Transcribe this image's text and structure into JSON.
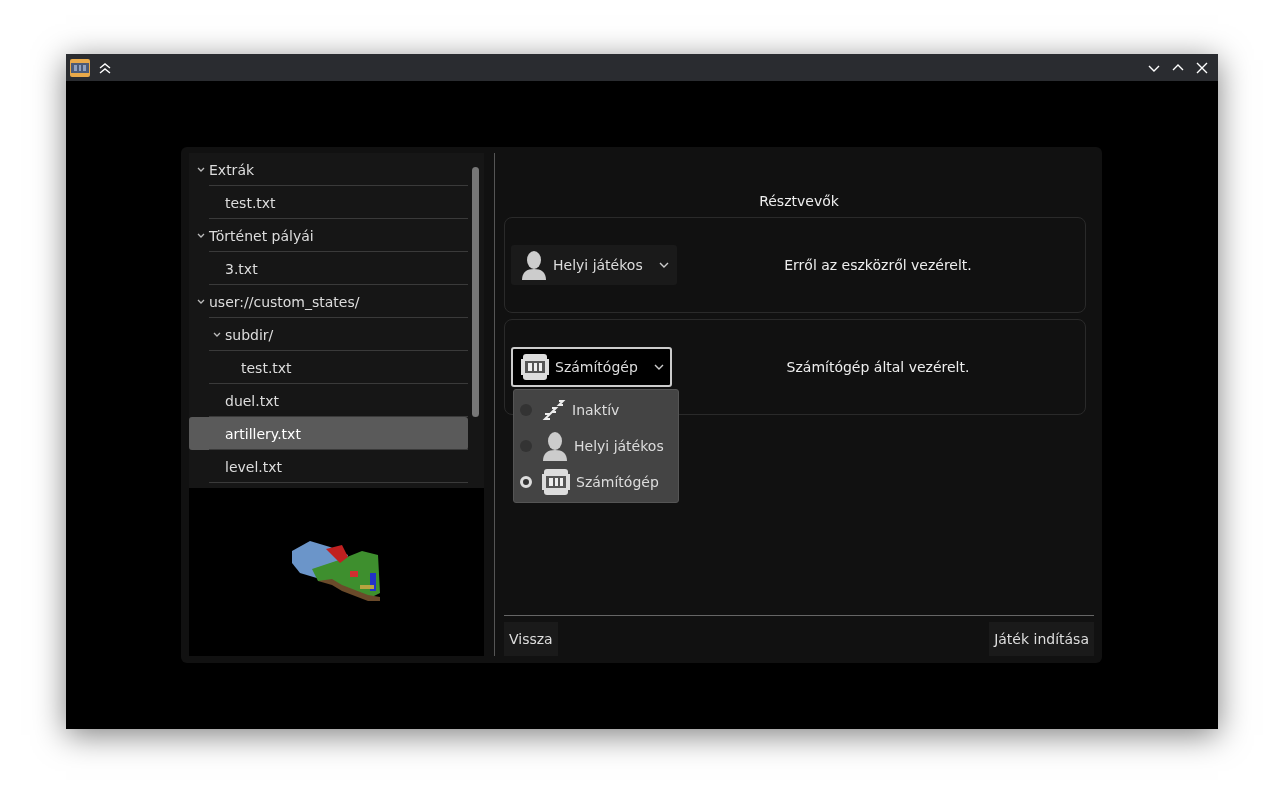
{
  "tree": [
    {
      "label": "Extrák",
      "expanded": true,
      "selected": false,
      "children": [
        {
          "label": "test.txt",
          "selected": false
        }
      ]
    },
    {
      "label": "Történet pályái",
      "expanded": true,
      "selected": false,
      "children": [
        {
          "label": "3.txt",
          "selected": false
        }
      ]
    },
    {
      "label": "user://custom_states/",
      "expanded": true,
      "selected": false,
      "children": [
        {
          "label": "subdir/",
          "expanded": true,
          "selected": false,
          "children": [
            {
              "label": "test.txt",
              "selected": false
            }
          ]
        },
        {
          "label": "duel.txt",
          "selected": false
        },
        {
          "label": "artillery.txt",
          "selected": true
        },
        {
          "label": "level.txt",
          "selected": false
        }
      ]
    }
  ],
  "participants": {
    "title": "Résztvevők",
    "players": [
      {
        "choice": {
          "kind": "person",
          "label": "Helyi játékos"
        },
        "open": false,
        "description": "Erről az eszközről vezérelt."
      },
      {
        "choice": {
          "kind": "computer",
          "label": "Számítógép"
        },
        "open": true,
        "description": "Számítógép által vezérelt.",
        "options": [
          {
            "kind": "sleep",
            "label": "Inaktív",
            "selected": false
          },
          {
            "kind": "person",
            "label": "Helyi játékos",
            "selected": false
          },
          {
            "kind": "computer",
            "label": "Számítógép",
            "selected": true
          }
        ]
      }
    ]
  },
  "buttons": {
    "back": "Vissza",
    "start": "Játék indítása"
  }
}
